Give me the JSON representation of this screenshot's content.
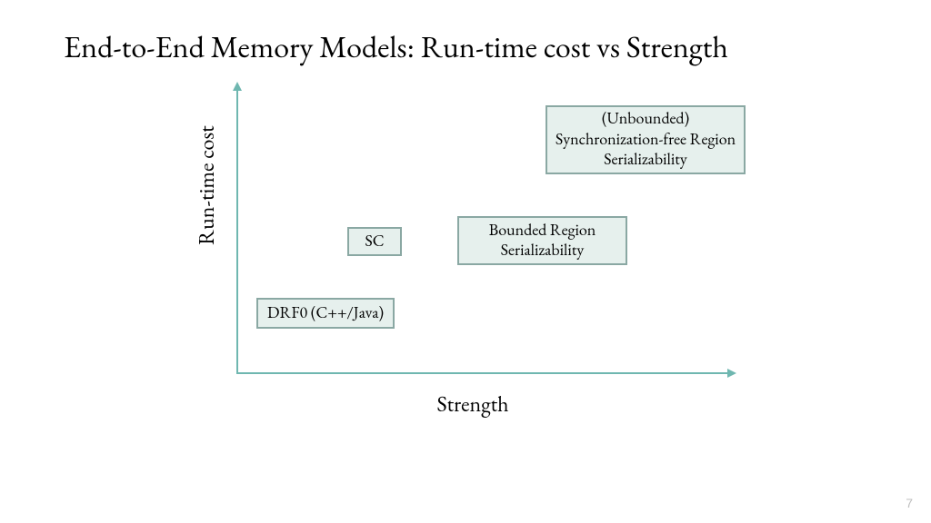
{
  "title": "End-to-End Memory Models: Run-time cost vs Strength",
  "ylabel": "Run-time cost",
  "xlabel": "Strength",
  "page": "7",
  "chart_data": {
    "type": "scatter",
    "title": "End-to-End Memory Models: Run-time cost vs Strength",
    "xlabel": "Strength",
    "ylabel": "Run-time cost",
    "xlim": [
      0,
      10
    ],
    "ylim": [
      0,
      10
    ],
    "series": [
      {
        "name": "DRF0 (C++/Java)",
        "x": 1.5,
        "y": 2.5
      },
      {
        "name": "SC",
        "x": 3.0,
        "y": 5.0
      },
      {
        "name": "Bounded Region Serializability",
        "x": 6.0,
        "y": 5.3
      },
      {
        "name": "(Unbounded) Synchronization-free Region Serializability",
        "x": 8.0,
        "y": 8.7
      }
    ]
  }
}
